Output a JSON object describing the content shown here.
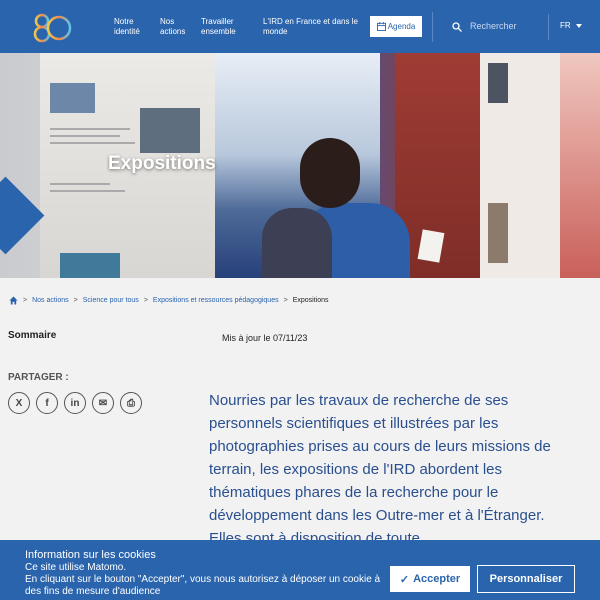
{
  "header": {
    "logo_text": "80",
    "nav": [
      {
        "label": "Notre identité"
      },
      {
        "label": "Nos actions"
      },
      {
        "label": "Travailler ensemble"
      },
      {
        "label": "L'IRD en France et dans le monde"
      }
    ],
    "agenda_label": "Agenda",
    "search_label": "Rechercher",
    "lang": "FR"
  },
  "hero": {
    "title": "Expositions"
  },
  "breadcrumb": {
    "items": [
      "Nos actions",
      "Science pour tous",
      "Expositions et ressources pédagogiques"
    ],
    "current": "Expositions"
  },
  "content": {
    "sommaire": "Sommaire",
    "updated": "Mis à jour le 07/11/23",
    "partager": "PARTAGER :",
    "share": [
      "X",
      "f",
      "in",
      "✉",
      "⎙"
    ],
    "intro": "Nourries par les travaux de recherche de ses personnels scientifiques et illustrées par les photographies prises au cours de leurs missions de terrain, les expositions de l'IRD abordent les thématiques phares de la recherche pour le développement dans les Outre-mer et à l'Étranger. Elles sont à disposition de toute"
  },
  "cookie": {
    "title": "Information sur les cookies",
    "text1": "Ce site utilise Matomo.",
    "text2": "En cliquant sur le bouton \"Accepter\", vous nous autorisez à déposer un cookie à des fins de mesure d'audience",
    "accept": "Accepter",
    "custom": "Personnaliser"
  },
  "colors": {
    "brand_blue": "#2a64ad",
    "text_blue": "#2a4f8f"
  }
}
